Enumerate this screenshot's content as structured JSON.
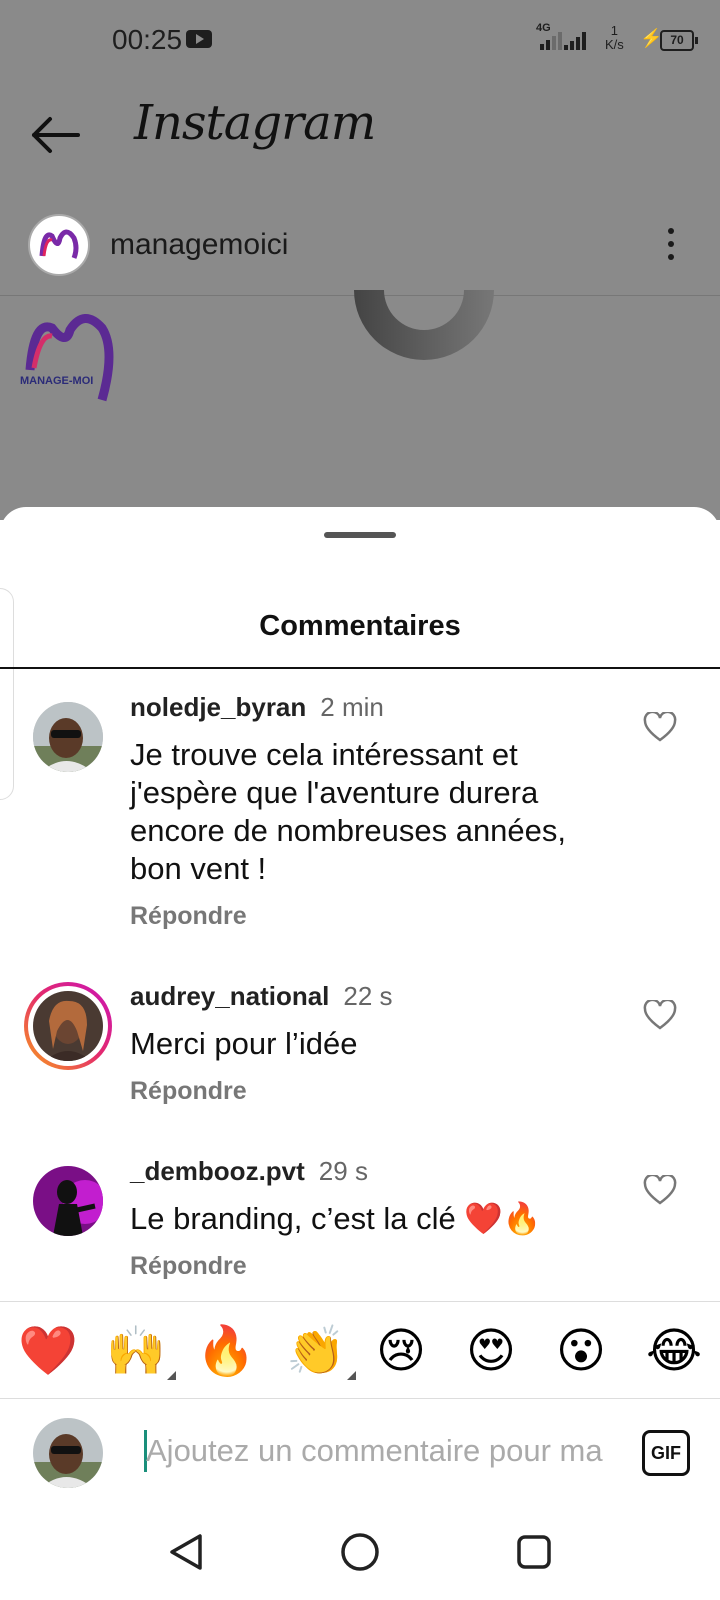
{
  "status_bar": {
    "time": "00:25",
    "network": "4G",
    "speed_value": "1",
    "speed_unit": "K/s",
    "battery": "70"
  },
  "header": {
    "title": "Instagram"
  },
  "post": {
    "username": "managemoici",
    "logo_text": "MANAGE-MOI"
  },
  "sheet": {
    "title": "Commentaires"
  },
  "comments": [
    {
      "username": "noledje_byran",
      "time": "2 min",
      "text": "Je trouve cela intéressant et j'espère que l'aventure durera encore de nombreuses années, bon vent !",
      "reply_label": "Répondre"
    },
    {
      "username": "audrey_national",
      "time": "22 s",
      "text": "Merci pour l’idée",
      "reply_label": "Répondre"
    },
    {
      "username": "_dembooz.pvt",
      "time": "29 s",
      "text": "Le branding, c’est la clé ❤️🔥",
      "reply_label": "Répondre"
    }
  ],
  "emoji_bar": [
    {
      "name": "red-heart",
      "glyph": "❤️"
    },
    {
      "name": "raising-hands",
      "glyph": "🙌"
    },
    {
      "name": "fire",
      "glyph": "🔥"
    },
    {
      "name": "clapping-hands",
      "glyph": "👏"
    },
    {
      "name": "crying-face",
      "glyph": "😢"
    },
    {
      "name": "heart-eyes",
      "glyph": "😍"
    },
    {
      "name": "astonished-face",
      "glyph": "😮"
    },
    {
      "name": "tears-of-joy",
      "glyph": "😂"
    }
  ],
  "composer": {
    "placeholder": "Ajoutez un commentaire pour ma",
    "gif_label": "GIF"
  },
  "icons": {
    "back": "arrow-left-icon",
    "more": "more-vertical-icon",
    "like": "heart-outline-icon",
    "nav_back": "triangle-back-icon",
    "nav_home": "circle-home-icon",
    "nav_recents": "square-recents-icon"
  },
  "colors": {
    "overlay": "#8a8a8a",
    "sheet": "#ffffff",
    "story_ring_start": "#c913b9",
    "story_ring_end": "#f9a21b",
    "cursor": "#1a8f7b"
  }
}
